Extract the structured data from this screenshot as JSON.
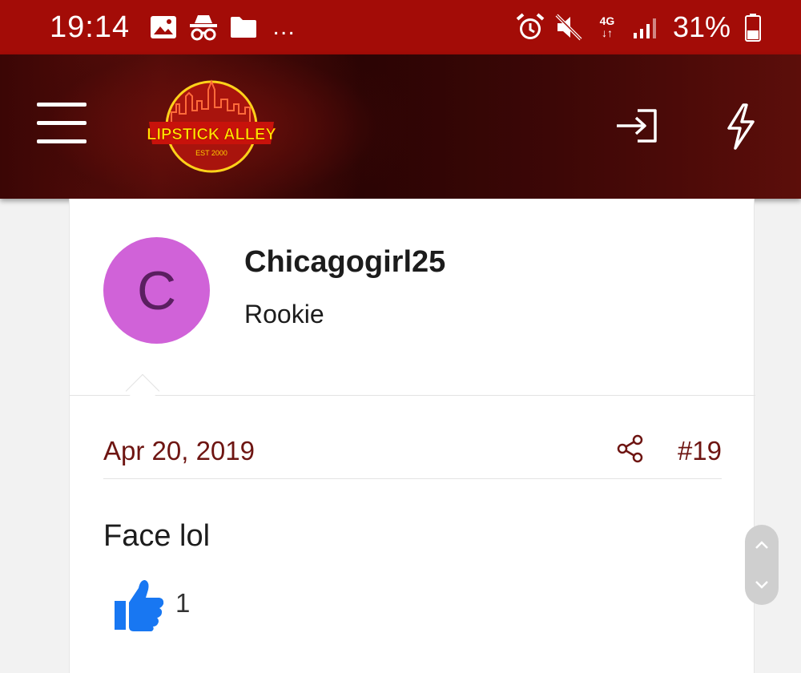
{
  "status_bar": {
    "time": "19:14",
    "more": "…",
    "network": "4G",
    "battery": "31%",
    "icons": [
      "image-icon",
      "incognito-icon",
      "folder-icon",
      "alarm-icon",
      "mute-icon",
      "signal-icon",
      "battery-icon"
    ]
  },
  "header": {
    "logo_text": "LIPSTICK ALLEY",
    "logo_subtext": "EST 2000",
    "icons": [
      "hamburger-menu-icon",
      "login-icon",
      "lightning-icon"
    ],
    "background_color": "#a30c07"
  },
  "post": {
    "user": {
      "avatar_letter": "C",
      "avatar_color": "#d062d8",
      "username": "Chicagogirl25",
      "title": "Rookie"
    },
    "date": "Apr 20, 2019",
    "post_number": "#19",
    "body": "Face lol",
    "reaction_count": "1"
  },
  "colors": {
    "link": "#6e1512",
    "reaction_blue": "#1877f2"
  }
}
